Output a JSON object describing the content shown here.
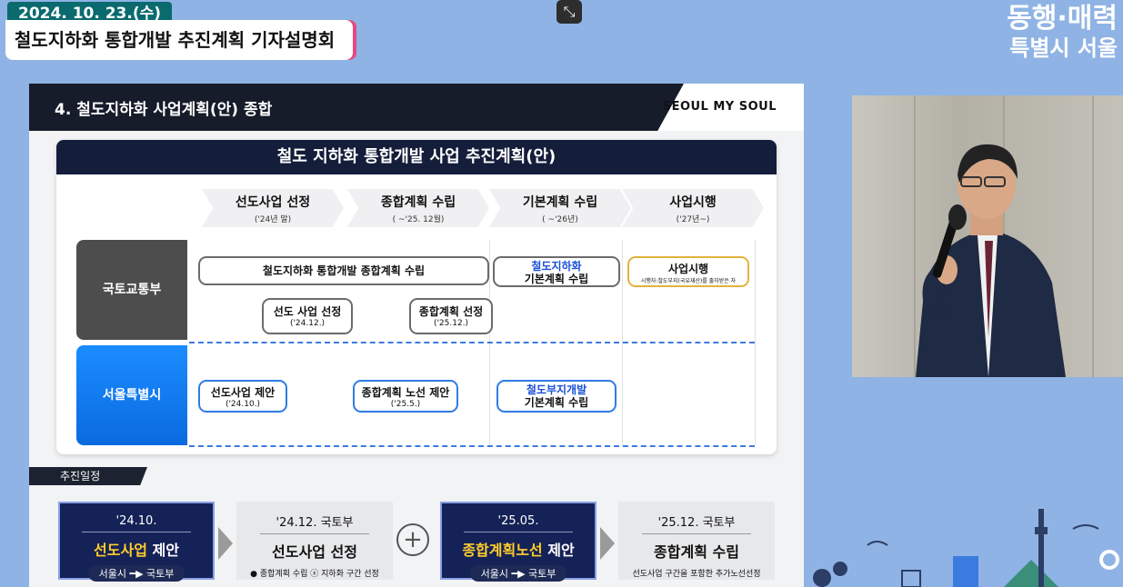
{
  "broadcast": {
    "date": "2024. 10. 23.(수)",
    "caption": "철도지하화 통합개발 추진계획 기자설명회",
    "logo_line1": "동행·매력",
    "logo_line2": "특별시 서울"
  },
  "slide": {
    "section_title": "4. 철도지하화 사업계획(안) 종합",
    "brand": "SEOUL MY SOUL",
    "panel_title": "철도 지하화 통합개발 사업 추진계획(안)",
    "phases": [
      {
        "label": "선도사업 선정",
        "sub": "('24년 말)"
      },
      {
        "label": "종합계획 수립",
        "sub": "( ~'25. 12월)"
      },
      {
        "label": "기본계획 수립",
        "sub": "( ~'26년)"
      },
      {
        "label": "사업시행",
        "sub": "('27년~)"
      }
    ],
    "rows": {
      "ministry": "국토교통부",
      "seoul": "서울특별시"
    },
    "ministry_boxes": {
      "comprehensive": "철도지하화 통합개발 종합계획 수립",
      "basic_l1": "철도지하화",
      "basic_l2": "기본계획 수립",
      "exec": "사업시행",
      "exec_sub": "시행자:철도부지(국유재산)를 출자받은 자",
      "lead_sel": "선도 사업 선정",
      "lead_sel_date": "('24.12.)",
      "comp_sel": "종합계획 선정",
      "comp_sel_date": "('25.12.)"
    },
    "seoul_boxes": {
      "lead_prop": "선도사업 제안",
      "lead_prop_date": "('24.10.)",
      "route_prop": "종합계획 노선 제안",
      "route_prop_date": "('25.5.)",
      "site_l1": "철도부지개발",
      "site_l2": "기본계획 수립"
    },
    "schedule_tag": "추진일정",
    "schedule": [
      {
        "top": "'24.10.",
        "main_hl": "선도사업",
        "main_rest": " 제안",
        "route": "서울시 ━▶ 국토부"
      },
      {
        "top": "'24.12. 국토부",
        "main": "선도사업 선정",
        "note": "● 종합계획 수립 ⓧ 지하화 구간 선정"
      },
      {
        "top": "'25.05.",
        "main_hl": "종합계획노선",
        "main_rest": " 제안",
        "route": "서울시 ━▶ 국토부"
      },
      {
        "top": "'25.12. 국토부",
        "main": "종합계획 수립",
        "note": "선도사업 구간을 포함한 추가노선선정"
      }
    ],
    "plus": "+"
  },
  "icons": {
    "shrink": "shrink-icon"
  }
}
